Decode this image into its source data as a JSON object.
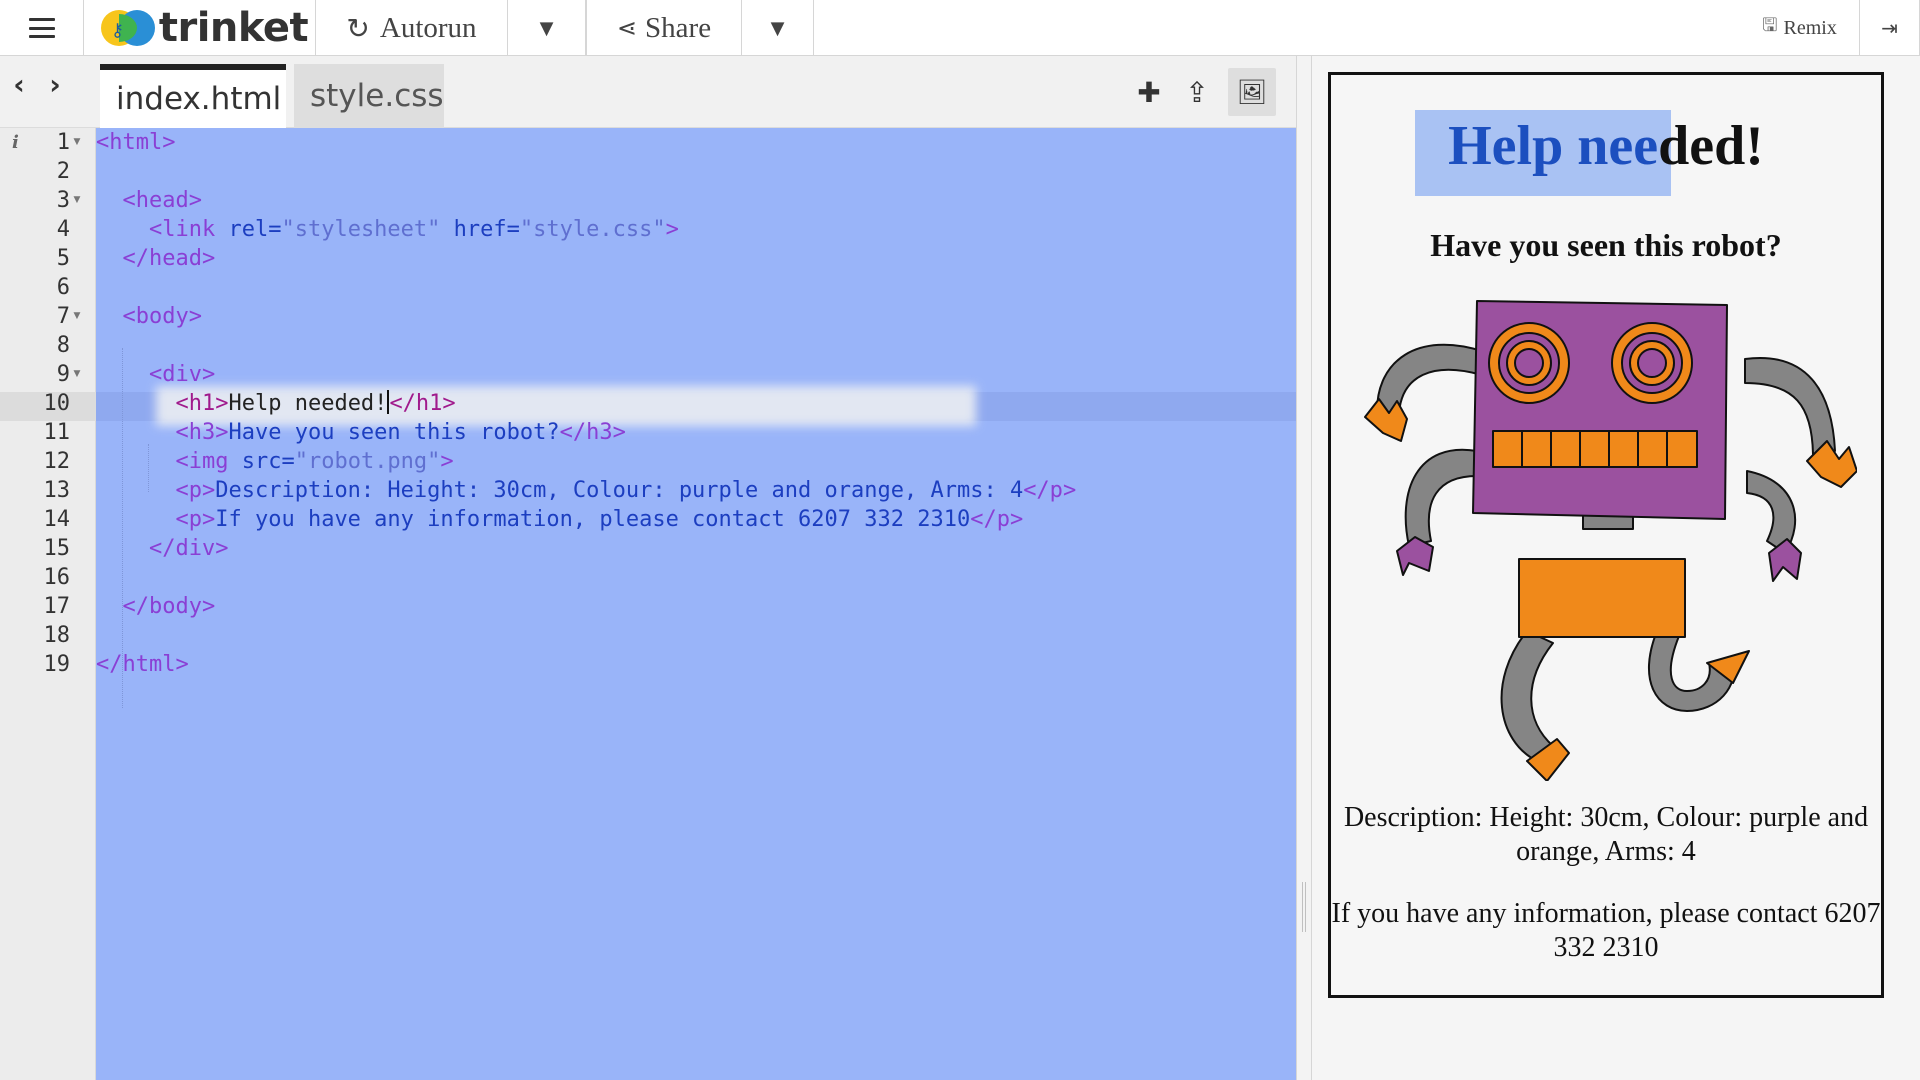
{
  "toolbar": {
    "app_name": "trinket",
    "autorun_label": "Autorun",
    "share_label": "Share",
    "remix_label": "Remix",
    "icons": {
      "menu": "hamburger-menu-icon",
      "autorun": "refresh-icon",
      "share": "share-icon",
      "remix": "save-icon",
      "login": "sign-in-icon"
    }
  },
  "editor": {
    "tabs": [
      {
        "label": "index.html",
        "active": true
      },
      {
        "label": "style.css",
        "active": false
      }
    ],
    "active_line": 10,
    "line_numbers": [
      "1",
      "2",
      "3",
      "4",
      "5",
      "6",
      "7",
      "8",
      "9",
      "10",
      "11",
      "12",
      "13",
      "14",
      "15",
      "16",
      "17",
      "18",
      "19"
    ],
    "code_lines": [
      "<html>",
      "",
      "  <head>",
      "    <link rel=\"stylesheet\" href=\"style.css\">",
      "  </head>",
      "",
      "  <body>",
      "",
      "    <div>",
      "      <h1>Help needed!</h1>",
      "      <h3>Have you seen this robot?</h3>",
      "      <img src=\"robot.png\">",
      "      <p>Description: Height: 30cm, Colour: purple and orange, Arms: 4</p>",
      "      <p>If you have any information, please contact 6207 332 2310</p>",
      "    </div>",
      "",
      "  </body>",
      "",
      "</html>"
    ],
    "colors": {
      "selection": "#99b4f9",
      "tag": "#8a3fd4",
      "attr": "#1c3ec0"
    }
  },
  "preview": {
    "h1_selected": "Help nee",
    "h1_rest": "ded!",
    "h3": "Have you seen this robot?",
    "description": "Description: Height: 30cm, Colour: purple and orange, Arms: 4",
    "contact": "If you have any information, please contact 6207 332 2310",
    "image_colors": {
      "body": "#9b519f",
      "accent": "#f0891a",
      "limbs": "#858585"
    }
  }
}
